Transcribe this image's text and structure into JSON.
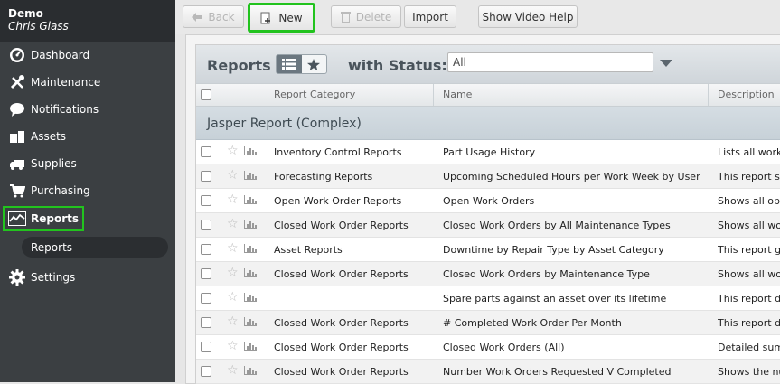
{
  "user": {
    "org": "Demo",
    "name": "Chris Glass"
  },
  "sidebar": {
    "items": [
      {
        "label": "Dashboard",
        "icon": "dashboard-icon"
      },
      {
        "label": "Maintenance",
        "icon": "tools-icon"
      },
      {
        "label": "Notifications",
        "icon": "speech-bubble-icon"
      },
      {
        "label": "Assets",
        "icon": "boxes-icon"
      },
      {
        "label": "Supplies",
        "icon": "truck-icon"
      },
      {
        "label": "Purchasing",
        "icon": "cart-icon"
      },
      {
        "label": "Reports",
        "icon": "line-chart-icon",
        "active": true
      },
      {
        "label": "Settings",
        "icon": "gear-icon"
      }
    ],
    "sub_item": "Reports"
  },
  "toolbar": {
    "back": "Back",
    "new": "New",
    "delete": "Delete",
    "import": "Import",
    "video": "Show Video Help"
  },
  "panel": {
    "title": "Reports",
    "status_label": "with Status:",
    "status_value": "All"
  },
  "columns": [
    "Report Category",
    "Name",
    "Description"
  ],
  "group": "Jasper Report (Complex)",
  "rows": [
    {
      "category": "Inventory Control Reports",
      "name": "Part Usage History",
      "description": "Lists all work o"
    },
    {
      "category": "Forecasting Reports",
      "name": "Upcoming Scheduled Hours per Work Week by User",
      "description": "This report sho"
    },
    {
      "category": "Open Work Order Reports",
      "name": "Open Work Orders",
      "description": "Shows all oper"
    },
    {
      "category": "Closed Work Order Reports",
      "name": "Closed Work Orders by All Maintenance Types",
      "description": "Shows all work"
    },
    {
      "category": "Asset Reports",
      "name": "Downtime by Repair Type by Asset Category",
      "description": "This report giv"
    },
    {
      "category": "Closed Work Order Reports",
      "name": "Closed Work Orders by Maintenance Type",
      "description": "Shows all work"
    },
    {
      "category": "",
      "name": "Spare parts against an asset over its lifetime",
      "description": "This report def"
    },
    {
      "category": "Closed Work Order Reports",
      "name": "# Completed Work Order Per Month",
      "description": "This report def"
    },
    {
      "category": "Closed Work Order Reports",
      "name": "Closed Work Orders (All)",
      "description": "Detailed summ"
    },
    {
      "category": "Closed Work Order Reports",
      "name": "Number Work Orders Requested V Completed",
      "description": "Shows the nur"
    }
  ],
  "colors": {
    "highlight": "#22c31e",
    "sidebar": "#3b3f42"
  }
}
